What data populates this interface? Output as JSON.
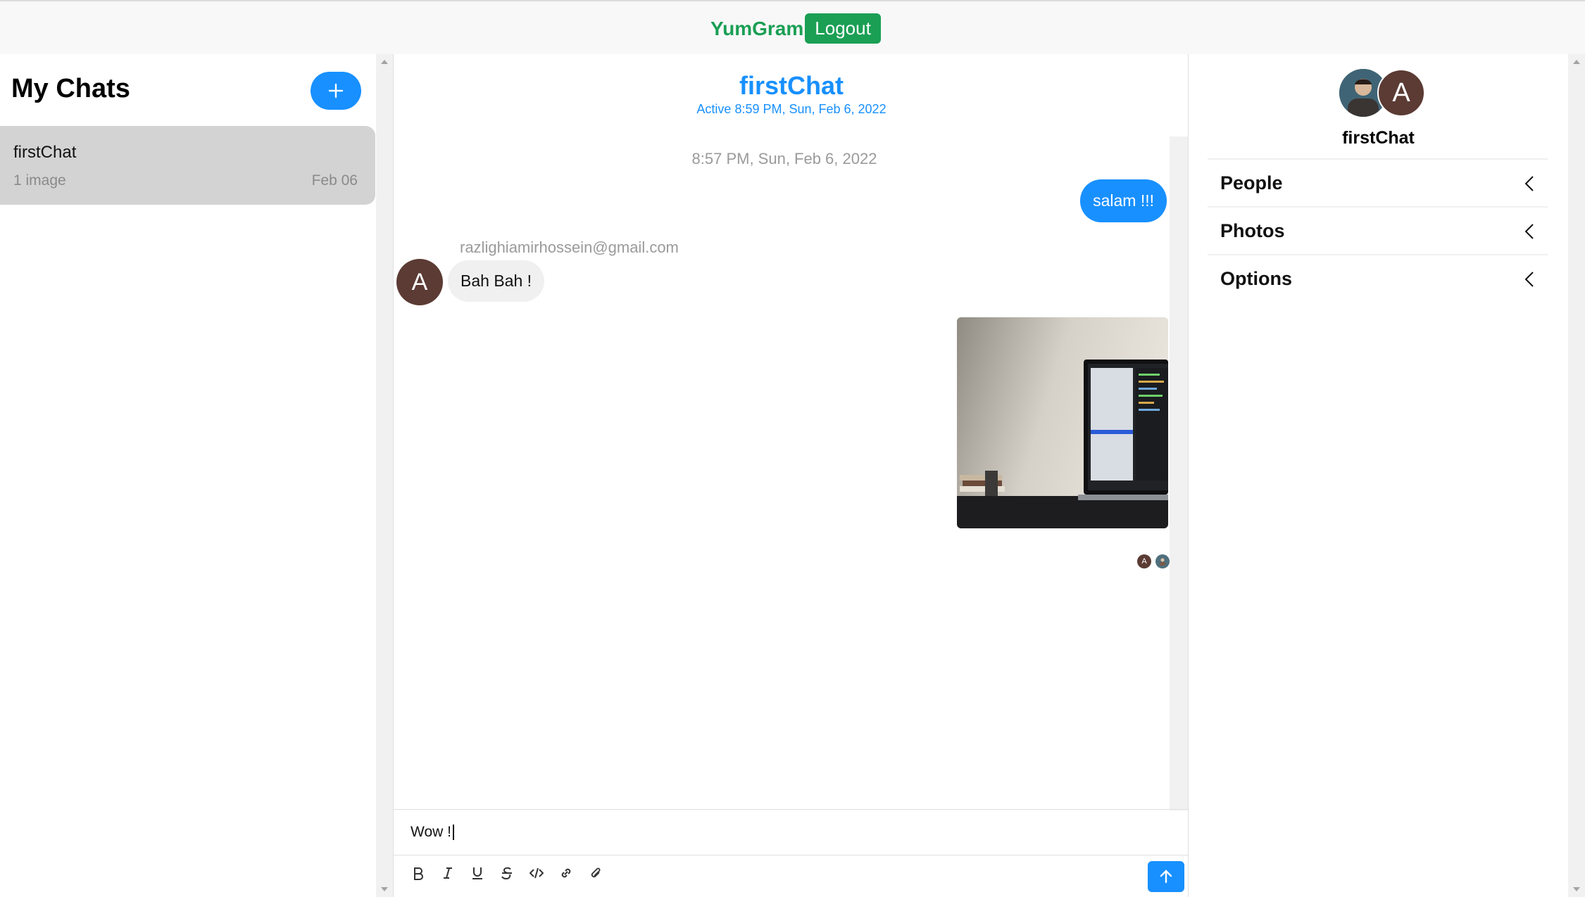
{
  "topbar": {
    "brand": "YumGram",
    "logout_label": "Logout"
  },
  "sidebar": {
    "title": "My Chats",
    "add_icon": "plus-icon",
    "chats": [
      {
        "title": "firstChat",
        "subtitle": "1 image",
        "date": "Feb 06"
      }
    ]
  },
  "chat": {
    "title": "firstChat",
    "active": "Active 8:59 PM, Sun, Feb 6, 2022",
    "date_divider": "8:57 PM, Sun, Feb 6, 2022",
    "messages": [
      {
        "from": "me",
        "text": "salam !!!"
      },
      {
        "from": "razlighiamirhossein@gmail.com",
        "avatar_letter": "A",
        "text": "Bah Bah !"
      }
    ],
    "read_receipts": [
      "A",
      ""
    ],
    "composer_value": "Wow !",
    "toolbar": [
      "bold-icon",
      "italic-icon",
      "underline-icon",
      "strikethrough-icon",
      "code-icon",
      "link-icon",
      "attachment-icon"
    ],
    "send_icon": "arrow-up-icon"
  },
  "details": {
    "avatar_letter": "A",
    "name": "firstChat",
    "sections": [
      "People",
      "Photos",
      "Options"
    ]
  },
  "colors": {
    "brand": "#1a9f54",
    "accent": "#1890ff",
    "avatar": "#5b3b34"
  }
}
